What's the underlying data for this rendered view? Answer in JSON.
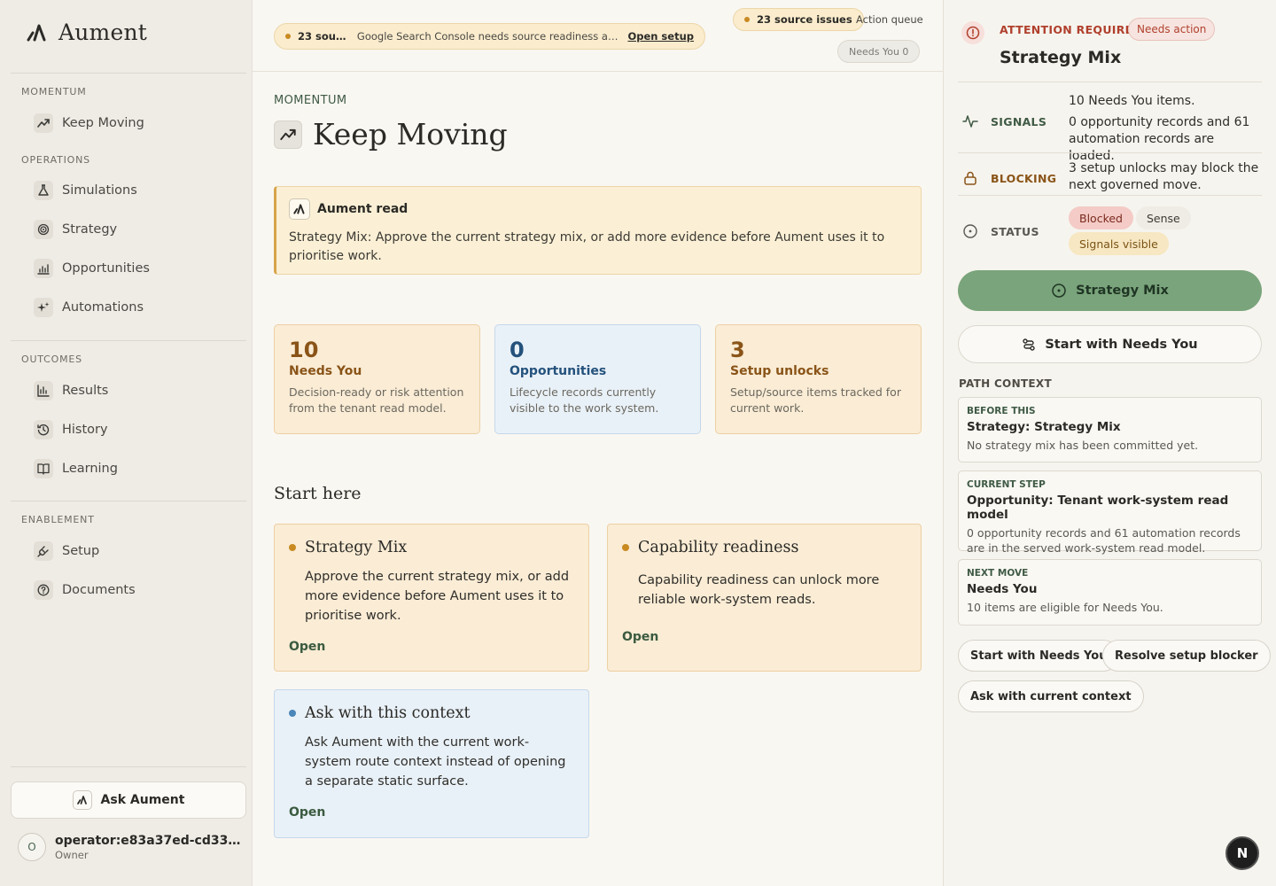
{
  "brand": {
    "name": "Aument"
  },
  "sidebar": {
    "sections": [
      {
        "label": "MOMENTUM",
        "items": [
          {
            "label": "Keep Moving",
            "icon": "trending-up-icon"
          }
        ]
      },
      {
        "label": "OPERATIONS",
        "items": [
          {
            "label": "Simulations",
            "icon": "flask-icon"
          },
          {
            "label": "Strategy",
            "icon": "target-icon"
          },
          {
            "label": "Opportunities",
            "icon": "chart-icon"
          },
          {
            "label": "Automations",
            "icon": "sparkles-icon"
          }
        ]
      },
      {
        "label": "OUTCOMES",
        "items": [
          {
            "label": "Results",
            "icon": "bar-chart-icon"
          },
          {
            "label": "History",
            "icon": "history-icon"
          },
          {
            "label": "Learning",
            "icon": "book-icon"
          }
        ]
      },
      {
        "label": "ENABLEMENT",
        "items": [
          {
            "label": "Setup",
            "icon": "plug-icon"
          },
          {
            "label": "Documents",
            "icon": "help-circle-icon"
          }
        ]
      }
    ],
    "ask_button": "Ask Aument",
    "user": {
      "initial": "O",
      "name": "operator:e83a37ed-cd33-41...",
      "role": "Owner"
    }
  },
  "topbar": {
    "banner": {
      "count": "23 sourc...",
      "message": "Google Search Console needs source readiness attenti...",
      "link": "Open setup"
    },
    "issues_pill": "23 source issues",
    "action_queue": "Action queue",
    "needs_pill": "Needs You 0"
  },
  "main": {
    "eyebrow": "MOMENTUM",
    "title": "Keep Moving",
    "read": {
      "heading": "Aument read",
      "text": "Strategy Mix: Approve the current strategy mix, or add more evidence before Aument uses it to prioritise work."
    },
    "stats": [
      {
        "value": "10",
        "label": "Needs You",
        "desc": "Decision-ready or risk attention from the tenant read model."
      },
      {
        "value": "0",
        "label": "Opportunities",
        "desc": "Lifecycle records currently visible to the work system."
      },
      {
        "value": "3",
        "label": "Setup unlocks",
        "desc": "Setup/source items tracked for current work."
      }
    ],
    "start_here": "Start here",
    "cards": [
      {
        "title": "Strategy Mix",
        "body": "Approve the current strategy mix, or add more evidence before Aument uses it to prioritise work.",
        "open": "Open"
      },
      {
        "title": "Capability readiness",
        "body": "Capability readiness can unlock more reliable work-system reads.",
        "open": "Open"
      },
      {
        "title": "Ask with this context",
        "body": "Ask Aument with the current work-system route context instead of opening a separate static surface.",
        "open": "Open"
      }
    ]
  },
  "right": {
    "attention_label": "ATTENTION REQUIRED",
    "needs_action": "Needs action",
    "title": "Strategy Mix",
    "signals_label": "SIGNALS",
    "signals_text": "10 Needs You items.",
    "signals_text2": "0 opportunity records and 61 automation records are loaded.",
    "blocking_label": "BLOCKING",
    "blocking_text": "3 setup unlocks may block the next governed move.",
    "status_label": "STATUS",
    "status_chips": [
      "Blocked",
      "Sense",
      "Signals visible"
    ],
    "primary_button": "Strategy Mix",
    "secondary_button": "Start with Needs You",
    "path_context": "PATH CONTEXT",
    "context": [
      {
        "eyebrow": "BEFORE THIS",
        "title": "Strategy: Strategy Mix",
        "desc": "No strategy mix has been committed yet."
      },
      {
        "eyebrow": "CURRENT STEP",
        "title": "Opportunity: Tenant work-system read model",
        "desc": "0 opportunity records and 61 automation records are in the served work-system read model."
      },
      {
        "eyebrow": "NEXT MOVE",
        "title": "Needs You",
        "desc": "10 items are eligible for Needs You."
      }
    ],
    "actions": [
      "Start with Needs You",
      "Resolve setup blocker",
      "Ask with current context"
    ]
  },
  "fab_label": "N"
}
